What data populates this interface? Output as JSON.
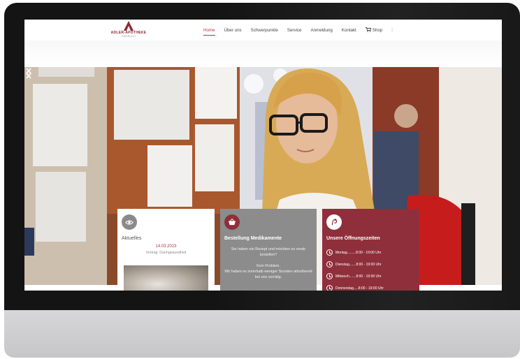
{
  "logo": {
    "name": "ADLER-APOTHEKE",
    "sub": "HAMBURG"
  },
  "nav": {
    "items": [
      "Home",
      "Über uns",
      "Schwerpunkte",
      "Service",
      "Anmeldung",
      "Kontakt",
      "Shop"
    ],
    "active": "Home",
    "separator": "|"
  },
  "hero": {
    "prev_icon": "chevron-left-icon",
    "next_icon": "chevron-right-icon"
  },
  "cards": {
    "news": {
      "icon": "eye-icon",
      "title": "Aktuelles",
      "date": "14.03.2023",
      "subtitle": "Vortrag: Darmgesundheit"
    },
    "order": {
      "icon": "basket-icon",
      "title": "Bestellung Medikamente",
      "line1": "Sie haben ein Rezept und möchten es vorab bestellen?",
      "line2": "Kein Problem.",
      "line3": "Wir haben es innerhalb weniger Stunden abholbereit bei uns vorrätig."
    },
    "hours": {
      "icon": "pharmacy-sign-icon",
      "title": "Unsere Öffnungszeiten",
      "rows": [
        "Montag.........8:00 - 19:00 Uhr",
        "Dienstag.......8:00 - 19:00 Uhr",
        "Mittwoch.......8:00 - 19:00 Uhr",
        "Donnerstag.....8:00 - 19:00 Uhr"
      ]
    }
  },
  "colors": {
    "accent": "#b8323e",
    "card_grey": "#8c8c8c",
    "card_red": "#8f2f3b"
  }
}
